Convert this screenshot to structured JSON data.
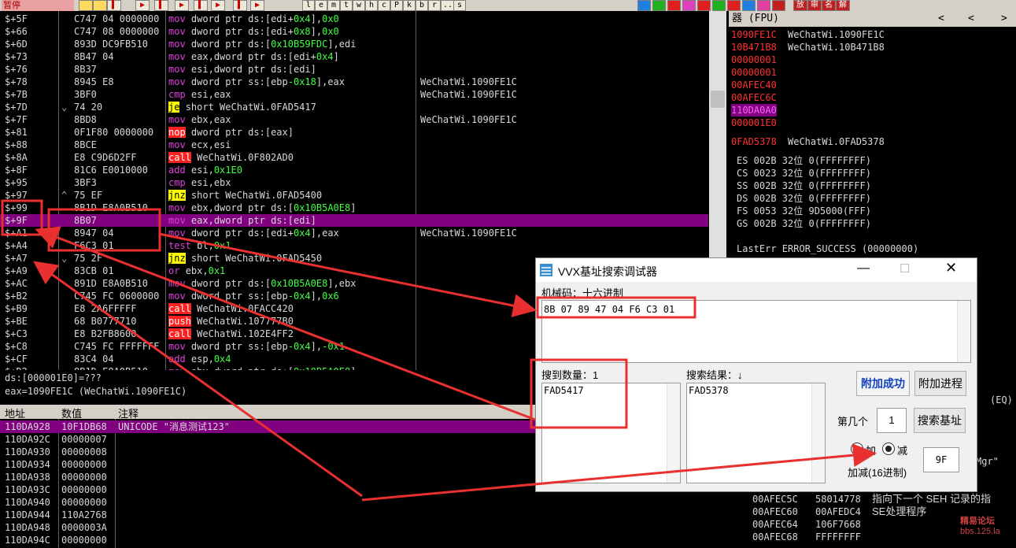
{
  "toolbar": {
    "status": "暂停",
    "letters": [
      "l",
      "e",
      "m",
      "t",
      "w",
      "h",
      "c",
      "P",
      "k",
      "b",
      "r",
      "...",
      "s"
    ],
    "right_icons": [
      "放",
      "审",
      "名",
      "解"
    ]
  },
  "disasm": {
    "rows": [
      {
        "addr": "$+5F",
        "tr": "",
        "hex": "C747 04 0000000",
        "mn": "mov",
        "rest": "dword ptr ds:[edi+0x4],0x0",
        "cm": ""
      },
      {
        "addr": "$+66",
        "tr": "",
        "hex": "C747 08 0000000",
        "mn": "mov",
        "rest": "dword ptr ds:[edi+0x8],0x0",
        "cm": ""
      },
      {
        "addr": "$+6D",
        "tr": "",
        "hex": "893D DC9FB510",
        "mn": "mov",
        "rest": "dword ptr ds:[0x10B59FDC],edi",
        "cm": ""
      },
      {
        "addr": "$+73",
        "tr": "",
        "hex": "8B47 04",
        "mn": "mov",
        "rest": "eax,dword ptr ds:[edi+0x4]",
        "cm": ""
      },
      {
        "addr": "$+76",
        "tr": "",
        "hex": "8B37",
        "mn": "mov",
        "rest": "esi,dword ptr ds:[edi]",
        "cm": ""
      },
      {
        "addr": "$+78",
        "tr": "",
        "hex": "8945 E8",
        "mn": "mov",
        "rest": "dword ptr ss:[ebp-0x18],eax",
        "cm": "WeChatWi.1090FE1C"
      },
      {
        "addr": "$+7B",
        "tr": "",
        "hex": "3BF0",
        "mn": "cmp",
        "rest": "esi,eax",
        "cm": "WeChatWi.1090FE1C"
      },
      {
        "addr": "$+7D",
        "tr": "⌄",
        "hex": "74 20",
        "mn": "je",
        "rest": "short WeChatWi.0FAD5417",
        "cm": ""
      },
      {
        "addr": "$+7F",
        "tr": "",
        "hex": "8BD8",
        "mn": "mov",
        "rest": "ebx,eax",
        "cm": "WeChatWi.1090FE1C"
      },
      {
        "addr": "$+81",
        "tr": "",
        "hex": "0F1F80 0000000",
        "mn": "nop",
        "rest": "dword ptr ds:[eax]",
        "cm": ""
      },
      {
        "addr": "$+88",
        "tr": "",
        "hex": "8BCE",
        "mn": "mov",
        "rest": "ecx,esi",
        "cm": ""
      },
      {
        "addr": "$+8A",
        "tr": "",
        "hex": "E8 C9D6D2FF",
        "mn": "call",
        "rest": "WeChatWi.0F802AD0",
        "cm": ""
      },
      {
        "addr": "$+8F",
        "tr": "",
        "hex": "81C6 E0010000",
        "mn": "add",
        "rest": "esi,0x1E0",
        "cm": ""
      },
      {
        "addr": "$+95",
        "tr": "",
        "hex": "3BF3",
        "mn": "cmp",
        "rest": "esi,ebx",
        "cm": ""
      },
      {
        "addr": "$+97",
        "tr": "^",
        "hex": "75 EF",
        "mn": "jnz",
        "rest": "short WeChatWi.0FAD5400",
        "cm": ""
      },
      {
        "addr": "$+99",
        "tr": "",
        "hex": "8B1D E8A0B510",
        "mn": "mov",
        "rest": "ebx,dword ptr ds:[0x10B5A0E8]",
        "cm": ""
      },
      {
        "addr": "$+9F",
        "tr": "",
        "hex": "8B07",
        "mn": "mov",
        "rest": "eax,dword ptr ds:[edi]",
        "cm": ""
      },
      {
        "addr": "$+A1",
        "tr": "",
        "hex": "8947 04",
        "mn": "mov",
        "rest": "dword ptr ds:[edi+0x4],eax",
        "cm": "WeChatWi.1090FE1C"
      },
      {
        "addr": "$+A4",
        "tr": "",
        "hex": "F6C3 01",
        "mn": "test",
        "rest": "bl,0x1",
        "cm": ""
      },
      {
        "addr": "$+A7",
        "tr": "⌄",
        "hex": "75 2F",
        "mn": "jnz",
        "rest": "short WeChatWi.0FAD5450",
        "cm": ""
      },
      {
        "addr": "$+A9",
        "tr": "",
        "hex": "83CB 01",
        "mn": "or",
        "rest": "ebx,0x1",
        "cm": ""
      },
      {
        "addr": "$+AC",
        "tr": "",
        "hex": "891D E8A0B510",
        "mn": "mov",
        "rest": "dword ptr ds:[0x10B5A0E8],ebx",
        "cm": ""
      },
      {
        "addr": "$+B2",
        "tr": "",
        "hex": "C745 FC 0600000",
        "mn": "mov",
        "rest": "dword ptr ss:[ebp-0x4],0x6",
        "cm": ""
      },
      {
        "addr": "$+B9",
        "tr": "",
        "hex": "E8 2A6FFFFF",
        "mn": "call",
        "rest": "WeChatWi.0FACC420",
        "cm": ""
      },
      {
        "addr": "$+BE",
        "tr": "",
        "hex": "68 B0777710",
        "mn": "push",
        "rest": "WeChatWi.107777B0",
        "cm": ""
      },
      {
        "addr": "$+C3",
        "tr": "",
        "hex": "E8 B2FB8600",
        "mn": "call",
        "rest": "WeChatWi.102E4FF2",
        "cm": ""
      },
      {
        "addr": "$+C8",
        "tr": "",
        "hex": "C745 FC FFFFFFF",
        "mn": "mov",
        "rest": "dword ptr ss:[ebp-0x4],-0x1",
        "cm": ""
      },
      {
        "addr": "$+CF",
        "tr": "",
        "hex": "83C4 04",
        "mn": "add",
        "rest": "esp,0x4",
        "cm": ""
      },
      {
        "addr": "$+D2",
        "tr": "",
        "hex": "8B1D E8A0B510",
        "mn": "mov",
        "rest": "ebx,dword ptr ds:[0x10B5A0E8]",
        "cm": ""
      }
    ],
    "selected_index": 16
  },
  "info": {
    "line1": "ds:[000001E0]=???",
    "line2": "eax=1090FE1C (WeChatWi.1090FE1C)"
  },
  "dump": {
    "headers": [
      "地址",
      "数值",
      "注释"
    ],
    "rows": [
      {
        "addr": "110DA928",
        "val": "10F1DB68",
        "cm": "UNICODE \"消息测试123\""
      },
      {
        "addr": "110DA92C",
        "val": "00000007",
        "cm": ""
      },
      {
        "addr": "110DA930",
        "val": "00000008",
        "cm": ""
      },
      {
        "addr": "110DA934",
        "val": "00000000",
        "cm": ""
      },
      {
        "addr": "110DA938",
        "val": "00000000",
        "cm": ""
      },
      {
        "addr": "110DA93C",
        "val": "00000000",
        "cm": ""
      },
      {
        "addr": "110DA940",
        "val": "00000000",
        "cm": ""
      },
      {
        "addr": "110DA944",
        "val": "110A2768",
        "cm": ""
      },
      {
        "addr": "110DA948",
        "val": "0000003A",
        "cm": ""
      },
      {
        "addr": "110DA94C",
        "val": "00000000",
        "cm": ""
      }
    ]
  },
  "registers": {
    "header": "器 (FPU)",
    "gp": [
      {
        "v": "1090FE1C",
        "n": "WeChatWi.1090FE1C"
      },
      {
        "v": "10B471B8",
        "n": "WeChatWi.10B471B8"
      },
      {
        "v": "00000001",
        "n": ""
      },
      {
        "v": "00000001",
        "n": ""
      },
      {
        "v": "00AFEC40",
        "n": ""
      },
      {
        "v": "00AFEC6C",
        "n": ""
      },
      {
        "v": "110DA0A0",
        "n": ""
      },
      {
        "v": "000001E0",
        "n": ""
      }
    ],
    "eip": {
      "v": "0FAD5378",
      "n": "WeChatWi.0FAD5378"
    },
    "segs": [
      "ES 002B 32位 0(FFFFFFFF)",
      "CS 0023 32位 0(FFFFFFFF)",
      "SS 002B 32位 0(FFFFFFFF)",
      "DS 002B 32位 0(FFFFFFFF)",
      "FS 0053 32位 9D5000(FFF)",
      "GS 002B 32位 0(FFFFFFFF)"
    ],
    "lasterr": "LastErr ERROR_SUCCESS (00000000)",
    "eq": "(EQ)",
    "mgr": "Mgr\""
  },
  "stack": {
    "rows": [
      {
        "a": "00AFEC5C",
        "v": "58014778",
        "c": "指向下一个 SEH 记录的指"
      },
      {
        "a": "00AFEC60",
        "v": "00AFEDC4",
        "c": "SE处理程序"
      },
      {
        "a": "00AFEC64",
        "v": "106F7668",
        "c": ""
      },
      {
        "a": "00AFEC68",
        "v": "FFFFFFFF",
        "c": ""
      }
    ]
  },
  "dialog": {
    "title": "VVX基址搜索调试器",
    "code_label": "机械码：十六进制",
    "code_value": "8B 07 89 47 04 F6 C3 01",
    "found_label": "搜到数量：1",
    "found_value": "FAD5417",
    "result_label": "搜索结果：↓",
    "result_value": "FAD5378",
    "attach_ok": "附加成功",
    "attach_proc": "附加进程",
    "nth_label": "第几个",
    "nth_value": "1",
    "search_btn": "搜索基址",
    "add_label": "加",
    "sub_label": "减",
    "addsub_label": "加减(16进制)",
    "addsub_value": "9F"
  },
  "watermark": {
    "line1": "精易论坛",
    "line2": "bbs.125.la"
  },
  "colors": {
    "selection": "#800080",
    "call": "#ff2020",
    "jump": "#ffff00",
    "mnemonic": "#e040e0",
    "immediate": "#40ff40",
    "annotation": "#e83030"
  }
}
